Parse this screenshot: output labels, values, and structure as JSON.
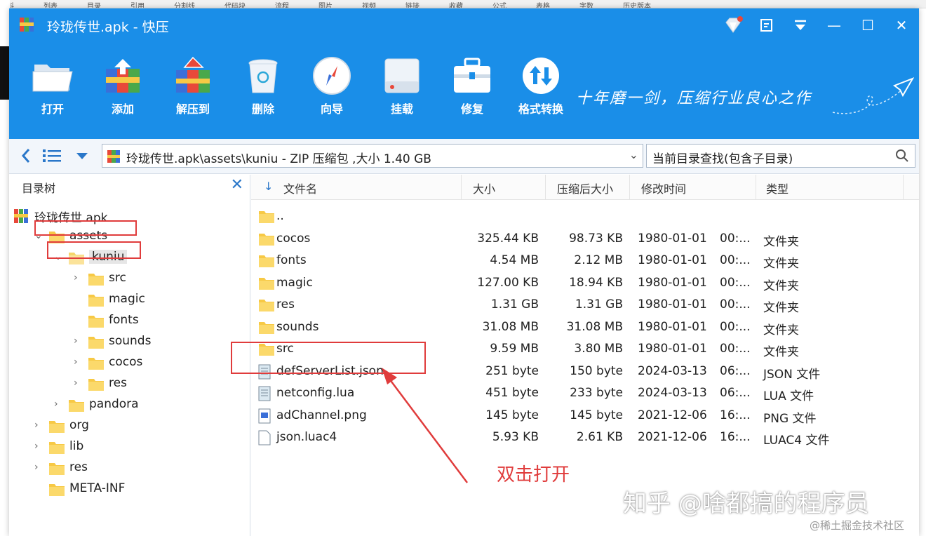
{
  "background": {
    "top_strip": [
      "资料",
      "列表",
      "目录",
      "引用",
      "分割线",
      "代码块",
      "流程",
      "图片",
      "视频",
      "链接",
      "收藏",
      "公式",
      "表格",
      "字数",
      "历史版本"
    ]
  },
  "window": {
    "title": "玲珑传世.apk - 快压",
    "controls": {
      "vip": "vip-icon",
      "feedback": "feedback-icon",
      "menu": "menu-icon",
      "min": "—",
      "max": "☐",
      "close": "✕"
    }
  },
  "toolbar": {
    "tools": [
      {
        "label": "打开",
        "icon": "folder-open-icon"
      },
      {
        "label": "添加",
        "icon": "add-archive-icon"
      },
      {
        "label": "解压到",
        "icon": "extract-archive-icon"
      },
      {
        "label": "删除",
        "icon": "recycle-bin-icon"
      },
      {
        "label": "向导",
        "icon": "compass-icon"
      },
      {
        "label": "挂载",
        "icon": "drive-icon"
      },
      {
        "label": "修复",
        "icon": "toolbox-icon"
      },
      {
        "label": "格式转换",
        "icon": "convert-icon"
      }
    ],
    "slogan": "十年磨一剑，压缩行业良心之作"
  },
  "addressbar": {
    "path": "玲珑传世.apk\\assets\\kuniu - ZIP 压缩包 ,大小 1.40 GB",
    "search_placeholder": "当前目录查找(包含子目录)"
  },
  "tree": {
    "title": "目录树",
    "close": "✕",
    "items": [
      {
        "name": "玲珑传世.apk",
        "level": 0,
        "chevron": "",
        "icon": "apk"
      },
      {
        "name": "assets",
        "level": 1,
        "chevron": "⌄",
        "icon": "folder"
      },
      {
        "name": "kuniu",
        "level": 2,
        "chevron": "⌄",
        "icon": "folder-selected"
      },
      {
        "name": "src",
        "level": 3,
        "chevron": "›",
        "icon": "folder"
      },
      {
        "name": "magic",
        "level": 3,
        "chevron": "",
        "icon": "folder"
      },
      {
        "name": "fonts",
        "level": 3,
        "chevron": "",
        "icon": "folder"
      },
      {
        "name": "sounds",
        "level": 3,
        "chevron": "›",
        "icon": "folder"
      },
      {
        "name": "cocos",
        "level": 3,
        "chevron": "›",
        "icon": "folder"
      },
      {
        "name": "res",
        "level": 3,
        "chevron": "›",
        "icon": "folder"
      },
      {
        "name": "pandora",
        "level": 2,
        "chevron": "›",
        "icon": "folder"
      },
      {
        "name": "org",
        "level": 1,
        "chevron": "›",
        "icon": "folder"
      },
      {
        "name": "lib",
        "level": 1,
        "chevron": "›",
        "icon": "folder"
      },
      {
        "name": "res",
        "level": 1,
        "chevron": "›",
        "icon": "folder"
      },
      {
        "name": "META-INF",
        "level": 1,
        "chevron": "",
        "icon": "folder"
      }
    ]
  },
  "list": {
    "sort_icon": "↓",
    "columns": [
      "文件名",
      "大小",
      "压缩后大小",
      "修改时间",
      "类型"
    ],
    "rows": [
      {
        "name": "..",
        "size": "",
        "packed": "",
        "date": "",
        "time": "",
        "type": "",
        "icon": "folder"
      },
      {
        "name": "cocos",
        "size": "325.44 KB",
        "packed": "98.73 KB",
        "date": "1980-01-01",
        "time": "00:...",
        "type": "文件夹",
        "icon": "folder"
      },
      {
        "name": "fonts",
        "size": "4.54 MB",
        "packed": "2.12 MB",
        "date": "1980-01-01",
        "time": "00:...",
        "type": "文件夹",
        "icon": "folder"
      },
      {
        "name": "magic",
        "size": "127.00 KB",
        "packed": "18.94 KB",
        "date": "1980-01-01",
        "time": "00:...",
        "type": "文件夹",
        "icon": "folder"
      },
      {
        "name": "res",
        "size": "1.31 GB",
        "packed": "1.31 GB",
        "date": "1980-01-01",
        "time": "00:...",
        "type": "文件夹",
        "icon": "folder"
      },
      {
        "name": "sounds",
        "size": "31.08 MB",
        "packed": "31.08 MB",
        "date": "1980-01-01",
        "time": "00:...",
        "type": "文件夹",
        "icon": "folder"
      },
      {
        "name": "src",
        "size": "9.59 MB",
        "packed": "3.80 MB",
        "date": "1980-01-01",
        "time": "00:...",
        "type": "文件夹",
        "icon": "folder"
      },
      {
        "name": "defServerList.json",
        "size": "251 byte",
        "packed": "150 byte",
        "date": "2024-03-13",
        "time": "06:...",
        "type": "JSON 文件",
        "icon": "text-file"
      },
      {
        "name": "netconfig.lua",
        "size": "451 byte",
        "packed": "233 byte",
        "date": "2024-03-13",
        "time": "06:...",
        "type": "LUA 文件",
        "icon": "text-file"
      },
      {
        "name": "adChannel.png",
        "size": "145 byte",
        "packed": "145 byte",
        "date": "2021-12-06",
        "time": "16:...",
        "type": "PNG 文件",
        "icon": "image-file"
      },
      {
        "name": "json.luac4",
        "size": "5.93 KB",
        "packed": "2.61 KB",
        "date": "2021-12-06",
        "time": "16:...",
        "type": "LUAC4 文件",
        "icon": "blank-file"
      }
    ]
  },
  "annotation": {
    "text": "双击打开",
    "color": "#e03c3c"
  },
  "watermark": {
    "main": "知乎 @啥都搞的程序员",
    "site": "@稀土掘金技术社区"
  },
  "colors": {
    "titlebar": "#1a8ee8",
    "accent": "#2a77c9",
    "folder": "#f7c945",
    "annotation": "#e03c3c"
  }
}
